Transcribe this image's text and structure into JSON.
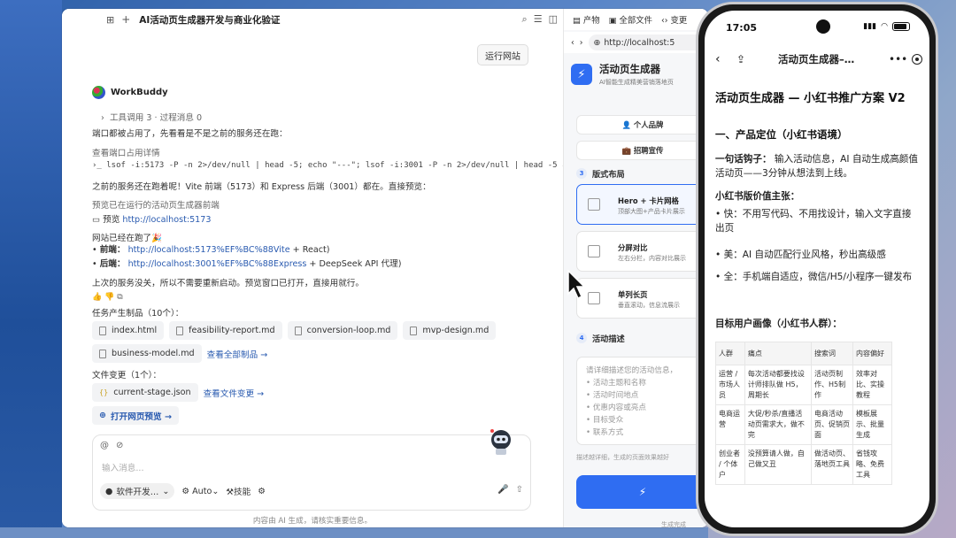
{
  "window": {
    "title": "AI活动页生成器开发与商业化验证"
  },
  "toolbar": {
    "run_site": "运行网站"
  },
  "bot": {
    "name": "WorkBuddy"
  },
  "messages": {
    "tools_line": "工具调用 3 · 过程消息 0",
    "port_busy": "端口都被占用了，先看看是不是之前的服务还在跑：",
    "check_port": "查看端口占用详情",
    "command": "lsof -i:5173 -P -n 2>/dev/null | head -5; echo \"---\"; lsof -i:3001 -P -n 2>/dev/null | head -5",
    "running": "之前的服务还在跑着呢！Vite 前端（5173）和 Express 后端（3001）都在。直接预览：",
    "preview_desc": "预览已在运行的活动页生成器前端",
    "preview_label": "预览",
    "preview_url": "http://localhost:5173",
    "site_running": "网站已经在跑了🎉",
    "frontend_label": "前端：",
    "frontend_url": "http://localhost:5173%EF%BC%88Vite",
    "frontend_suffix": " + React)",
    "backend_label": "后端：",
    "backend_url": "http://localhost:3001%EF%BC%88Express",
    "backend_suffix": " + DeepSeek API 代理)",
    "no_restart": "上次的服务没关，所以不需要重新启动。预览窗口已打开，直接用就行。",
    "artifacts_title": "任务产生制品（10个）：",
    "artifacts": [
      "index.html",
      "feasibility-report.md",
      "conversion-loop.md",
      "mvp-design.md",
      "business-model.md"
    ],
    "view_all": "查看全部制品 →",
    "changes_title": "文件变更（1个）：",
    "changed_file": "current-stage.json",
    "view_changes": "查看文件变更 →",
    "open_preview": "打开网页预览 →"
  },
  "input": {
    "placeholder": "输入消息...",
    "mode": "软件开发…",
    "auto": "Auto",
    "skills": "技能",
    "disclaimer": "内容由 AI 生成，请核实重要信息。"
  },
  "preview_panel": {
    "tabs": [
      "产物",
      "全部文件",
      "变更"
    ],
    "url": "http://localhost:5",
    "app_title": "活动页生成器",
    "app_sub": "AI智能生成精美营销落地页",
    "btn_personal": "👤 个人品牌",
    "btn_hiring": "💼 招聘宣传",
    "sec3_num": "3",
    "sec3": "版式布局",
    "layouts": [
      {
        "title": "Hero + 卡片网格",
        "sub": "顶部大图+产品卡片展示"
      },
      {
        "title": "分屏对比",
        "sub": "左右分栏，内容对比展示"
      },
      {
        "title": "单列长页",
        "sub": "垂直滚动，信息流展示"
      }
    ],
    "sec4_num": "4",
    "sec4": "活动描述",
    "ta_placeholder": "请详细描述您的活动信息，",
    "ta_items": [
      "活动主题和名称",
      "活动时间地点",
      "优惠内容或亮点",
      "目标受众",
      "联系方式"
    ],
    "hint": "描述越详细，生成的页面效果越好",
    "gen_note": "生成完成"
  },
  "phone": {
    "time": "17:05",
    "nav_title": "活动页生成器–…",
    "h1": "活动页生成器 — 小红书推广方案 V2",
    "h2": "一、产品定位（小红书语境）",
    "hook_label": "一句话钩子：",
    "hook_text": " 输入活动信息，AI 自动生成高颜值活动页——3分钟从想法到上线。",
    "value_title": "小红书版价值主张：",
    "v1": "• 快：不用写代码、不用找设计，输入文字直接出页",
    "v2": "• 美：AI 自动匹配行业风格，秒出高级感",
    "v3": "• 全：手机端自适应，微信/H5/小程序一键发布",
    "persona_title": "目标用户画像（小红书人群）：",
    "table_headers": [
      "人群",
      "痛点",
      "搜索词",
      "内容偏好"
    ],
    "table_rows": [
      [
        "运营 / 市场人员",
        "每次活动都要找设计师排队做 H5，周期长",
        "活动页制作、H5制作",
        "效率对比、实操教程"
      ],
      [
        "电商运营",
        "大促/秒杀/直播活动页需求大，做不完",
        "电商活动页、促销页面",
        "模板展示、批量生成"
      ],
      [
        "创业者 / 个体户",
        "没预算请人做，自己做又丑",
        "做活动页、落地页工具",
        "省钱攻略、免费工具"
      ]
    ]
  }
}
